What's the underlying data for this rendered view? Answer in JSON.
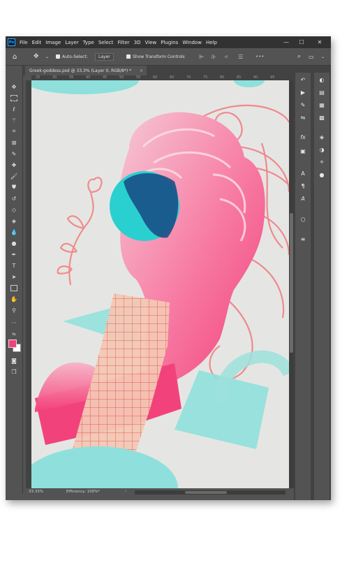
{
  "app": {
    "logo": "Ps"
  },
  "menu": [
    "File",
    "Edit",
    "Image",
    "Layer",
    "Type",
    "Select",
    "Filter",
    "3D",
    "View",
    "Plugins",
    "Window",
    "Help"
  ],
  "window_controls": {
    "minimize": "—",
    "maximize": "☐",
    "close": "✕"
  },
  "options": {
    "auto_select_label": "Auto-Select:",
    "auto_select_checked": true,
    "layer_dropdown": "Layer",
    "show_transform_label": "Show Transform Controls",
    "show_transform_checked": true
  },
  "document_tab": {
    "title": "Greek-goddess.psd @ 33.3% (Layer 0, RGB/8*) *",
    "close": "×"
  },
  "ruler": {
    "ticks": [
      "25",
      "30",
      "35",
      "40",
      "45",
      "50",
      "55",
      "60",
      "65",
      "70",
      "75",
      "80",
      "85",
      "90",
      "95"
    ]
  },
  "status": {
    "zoom": "33.33%",
    "efficiency": "Efficiency: 100%*",
    "arrow": "›"
  },
  "colors": {
    "foreground": "#f0427b",
    "background": "#ffffff",
    "accent_blue": "#31a8ff"
  },
  "toolbar_icons": [
    "move-icon",
    "marquee-icon",
    "lasso-icon",
    "magic-wand-icon",
    "crop-icon",
    "frame-icon",
    "eyedropper-icon",
    "healing-brush-icon",
    "brush-icon",
    "clone-stamp-icon",
    "history-brush-icon",
    "eraser-icon",
    "paint-bucket-icon",
    "blur-icon",
    "dodge-icon",
    "pen-icon",
    "type-icon",
    "path-selection-icon",
    "rectangle-icon",
    "hand-icon",
    "zoom-icon",
    "more-tools-icon",
    "swap-colors-icon",
    "quick-mask-icon",
    "screen-mode-icon"
  ],
  "dock_icons": {
    "left": [
      "history-icon",
      "actions-icon",
      "brush-settings-icon",
      "adjust-icon",
      "fx-icon",
      "character-style-icon",
      "character-icon",
      "paragraph-icon",
      "glyphs-icon",
      "3d-icon",
      "properties-icon"
    ],
    "right": [
      "color-icon",
      "swatches-icon",
      "gradients-icon",
      "patterns-icon",
      "layers-icon",
      "channels-icon",
      "paths-icon",
      "adjustments-icon"
    ]
  }
}
